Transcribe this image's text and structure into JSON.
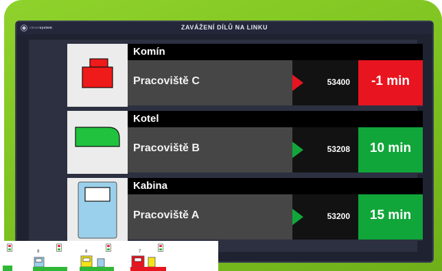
{
  "app": {
    "logo_brand": "clever",
    "logo_suffix": "system",
    "title": "ZAVÁŽENÍ DÍLŮ NA LINKU"
  },
  "rows": [
    {
      "part": "Komín",
      "workstation": "Pracoviště C",
      "code": "53400",
      "time": "-1 min",
      "status": "late",
      "status_color": "#e8141f",
      "icon": "chimney-icon",
      "icon_color": "#ef1a1a"
    },
    {
      "part": "Kotel",
      "workstation": "Pracoviště B",
      "code": "53208",
      "time": "10 min",
      "status": "ok",
      "status_color": "#11a63a",
      "icon": "boiler-icon",
      "icon_color": "#21c23e"
    },
    {
      "part": "Kabina",
      "workstation": "Pracoviště A",
      "code": "53200",
      "time": "15 min",
      "status": "ok",
      "status_color": "#11a63a",
      "icon": "cabin-icon",
      "icon_color": "#9bd0ec"
    }
  ],
  "sequence": [
    {
      "number": "",
      "color": "#2fb836"
    },
    {
      "number": "9",
      "color": "#9bd0ec"
    },
    {
      "number": "8",
      "color": "#f3e319"
    },
    {
      "number": "7",
      "color": "#e8141f"
    }
  ],
  "colors": {
    "frame_green": "#7cc11f",
    "screen_bg": "#2c3041",
    "late_red": "#e8141f",
    "ok_green": "#11a63a"
  }
}
